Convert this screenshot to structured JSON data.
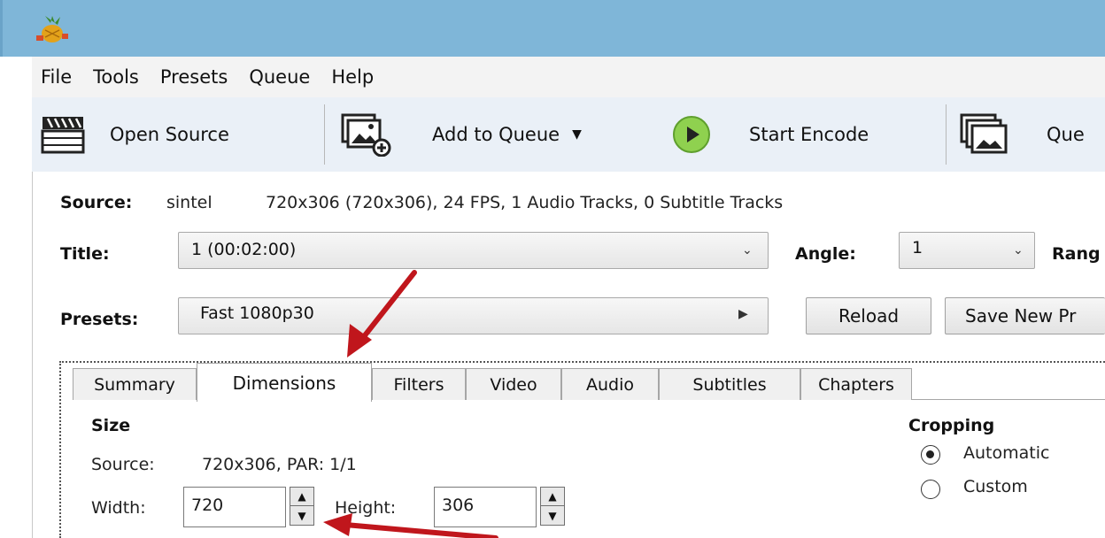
{
  "menu": {
    "items": [
      {
        "label": "File"
      },
      {
        "label": "Tools"
      },
      {
        "label": "Presets"
      },
      {
        "label": "Queue"
      },
      {
        "label": "Help"
      }
    ]
  },
  "toolbar": {
    "open_source": "Open Source",
    "add_to_queue": "Add to Queue",
    "start_encode": "Start Encode",
    "queue": "Que"
  },
  "source": {
    "label": "Source:",
    "name": "sintel",
    "info": "720x306 (720x306), 24 FPS, 1 Audio Tracks, 0 Subtitle Tracks"
  },
  "title": {
    "label": "Title:",
    "value": "1 (00:02:00)"
  },
  "angle": {
    "label": "Angle:",
    "value": "1"
  },
  "range": {
    "label": "Rang"
  },
  "presets": {
    "label": "Presets:",
    "value": "Fast 1080p30",
    "reload": "Reload",
    "save_new": "Save New Pr"
  },
  "tabs": [
    "Summary",
    "Dimensions",
    "Filters",
    "Video",
    "Audio",
    "Subtitles",
    "Chapters"
  ],
  "active_tab": "Dimensions",
  "dimensions": {
    "size_heading": "Size",
    "source_label": "Source:",
    "source_value": "720x306, PAR: 1/1",
    "width_label": "Width:",
    "width_value": "720",
    "height_label": "Height:",
    "height_value": "306"
  },
  "cropping": {
    "heading": "Cropping",
    "options": [
      "Automatic",
      "Custom"
    ],
    "selected": "Automatic"
  },
  "colors": {
    "annotation_arrow": "#c0161c",
    "titlebar": "#7fb6d8"
  }
}
